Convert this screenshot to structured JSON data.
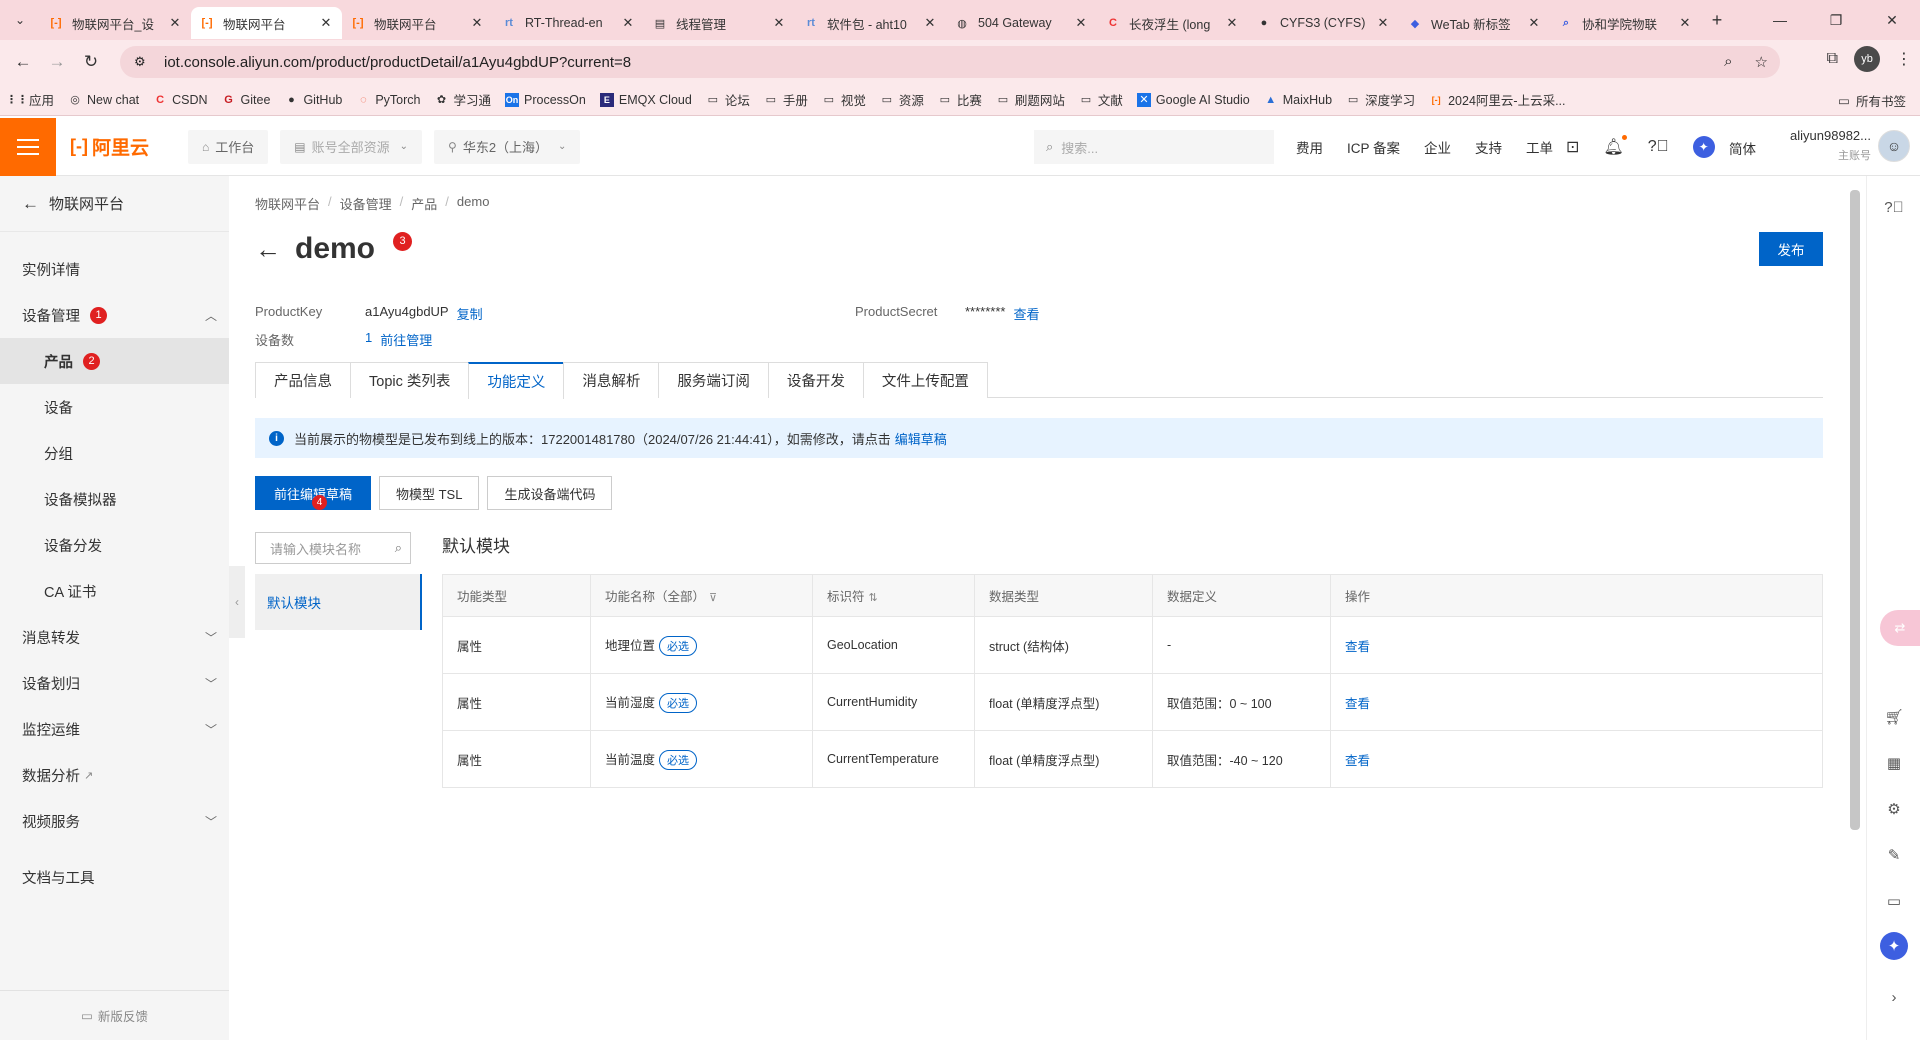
{
  "browser": {
    "tabs": [
      {
        "label": "物联网平台_设",
        "icon": "aliyun-icon",
        "active": false
      },
      {
        "label": "物联网平台",
        "icon": "aliyun-icon",
        "active": true
      },
      {
        "label": "物联网平台",
        "icon": "aliyun-icon",
        "active": false
      },
      {
        "label": "RT-Thread-en",
        "icon": "rtthread-icon",
        "active": false
      },
      {
        "label": "线程管理",
        "icon": "doc-icon",
        "active": false
      },
      {
        "label": "软件包 - aht10",
        "icon": "rtthread-icon",
        "active": false
      },
      {
        "label": "504 Gateway",
        "icon": "globe-icon",
        "active": false
      },
      {
        "label": "长夜浮生 (long",
        "icon": "csdn-icon",
        "active": false
      },
      {
        "label": "CYFS3 (CYFS)",
        "icon": "github-icon",
        "active": false
      },
      {
        "label": "WeTab 新标签",
        "icon": "wetab-icon",
        "active": false
      },
      {
        "label": "协和学院物联",
        "icon": "search-icon",
        "active": false
      }
    ],
    "url": "iot.console.aliyun.com/product/productDetail/a1Ayu4gbdUP?current=8",
    "profile_initials": "yb",
    "bookmarks": [
      {
        "label": "应用",
        "icon": "apps-icon"
      },
      {
        "label": "New chat",
        "icon": "chat-icon"
      },
      {
        "label": "CSDN",
        "icon": "csdn-icon"
      },
      {
        "label": "Gitee",
        "icon": "gitee-icon"
      },
      {
        "label": "GitHub",
        "icon": "github-icon"
      },
      {
        "label": "PyTorch",
        "icon": "pytorch-icon"
      },
      {
        "label": "学习通",
        "icon": "xuexitong-icon"
      },
      {
        "label": "ProcessOn",
        "icon": "processon-icon"
      },
      {
        "label": "EMQX Cloud",
        "icon": "emqx-icon"
      },
      {
        "label": "论坛",
        "icon": "folder-icon"
      },
      {
        "label": "手册",
        "icon": "folder-icon"
      },
      {
        "label": "视觉",
        "icon": "folder-icon"
      },
      {
        "label": "资源",
        "icon": "folder-icon"
      },
      {
        "label": "比赛",
        "icon": "folder-icon"
      },
      {
        "label": "刷题网站",
        "icon": "folder-icon"
      },
      {
        "label": "文献",
        "icon": "folder-icon"
      },
      {
        "label": "Google AI Studio",
        "icon": "google-ai-icon"
      },
      {
        "label": "MaixHub",
        "icon": "maixhub-icon"
      },
      {
        "label": "深度学习",
        "icon": "folder-icon"
      },
      {
        "label": "2024阿里云-上云采...",
        "icon": "aliyun-icon"
      }
    ],
    "all_bookmarks_label": "所有书签"
  },
  "console_header": {
    "brand": "阿里云",
    "workbench": "工作台",
    "resource_scope": "账号全部资源",
    "region": "华东2（上海）",
    "search_placeholder": "搜索...",
    "links": [
      "费用",
      "ICP 备案",
      "企业",
      "支持",
      "工单"
    ],
    "language": "简体",
    "username": "aliyun98982...",
    "user_role": "主账号"
  },
  "sidebar": {
    "back_label": "物联网平台",
    "items": [
      {
        "label": "实例详情"
      },
      {
        "label": "设备管理",
        "badge": "1"
      },
      {
        "label": "产品",
        "badge": "2"
      },
      {
        "label": "设备"
      },
      {
        "label": "分组"
      },
      {
        "label": "设备模拟器"
      },
      {
        "label": "设备分发"
      },
      {
        "label": "CA 证书"
      },
      {
        "label": "消息转发"
      },
      {
        "label": "设备划归"
      },
      {
        "label": "监控运维"
      },
      {
        "label": "数据分析"
      },
      {
        "label": "视频服务"
      },
      {
        "label": "文档与工具"
      }
    ],
    "feedback": "新版反馈"
  },
  "main": {
    "breadcrumb": [
      "物联网平台",
      "设备管理",
      "产品",
      "demo"
    ],
    "title": "demo",
    "title_badge": "3",
    "publish": "发布",
    "product_key_label": "ProductKey",
    "product_key": "a1Ayu4gbdUP",
    "copy": "复制",
    "product_secret_label": "ProductSecret",
    "product_secret": "********",
    "view": "查看",
    "device_count_label": "设备数",
    "device_count": "1",
    "go_manage": "前往管理",
    "tabs": [
      "产品信息",
      "Topic 类列表",
      "功能定义",
      "消息解析",
      "服务端订阅",
      "设备开发",
      "文件上传配置"
    ],
    "active_tab": "功能定义",
    "notice_text": "当前展示的物模型是已发布到线上的版本：1722001481780（2024/07/26 21:44:41），如需修改，请点击",
    "notice_link": "编辑草稿",
    "btn_edit_draft": "前往编辑草稿",
    "btn_edit_draft_badge": "4",
    "btn_tsl": "物模型 TSL",
    "btn_gen_code": "生成设备端代码",
    "module_search_placeholder": "请输入模块名称",
    "module_default": "默认模块",
    "section_title": "默认模块",
    "table": {
      "headers": [
        "功能类型",
        "功能名称（全部）",
        "标识符",
        "数据类型",
        "数据定义",
        "操作"
      ],
      "rows": [
        {
          "type": "属性",
          "name": "地理位置",
          "required": "必选",
          "identifier": "GeoLocation",
          "data_type": "struct (结构体)",
          "definition": "-",
          "action": "查看"
        },
        {
          "type": "属性",
          "name": "当前湿度",
          "required": "必选",
          "identifier": "CurrentHumidity",
          "data_type": "float (单精度浮点型)",
          "definition": "取值范围：0 ~ 100",
          "action": "查看"
        },
        {
          "type": "属性",
          "name": "当前温度",
          "required": "必选",
          "identifier": "CurrentTemperature",
          "data_type": "float (单精度浮点型)",
          "definition": "取值范围：-40 ~ 120",
          "action": "查看"
        }
      ]
    }
  },
  "colors": {
    "brand": "#ff6a00",
    "primary": "#0064c8",
    "badge": "#e02020",
    "chrome": "#f8d9dd"
  }
}
